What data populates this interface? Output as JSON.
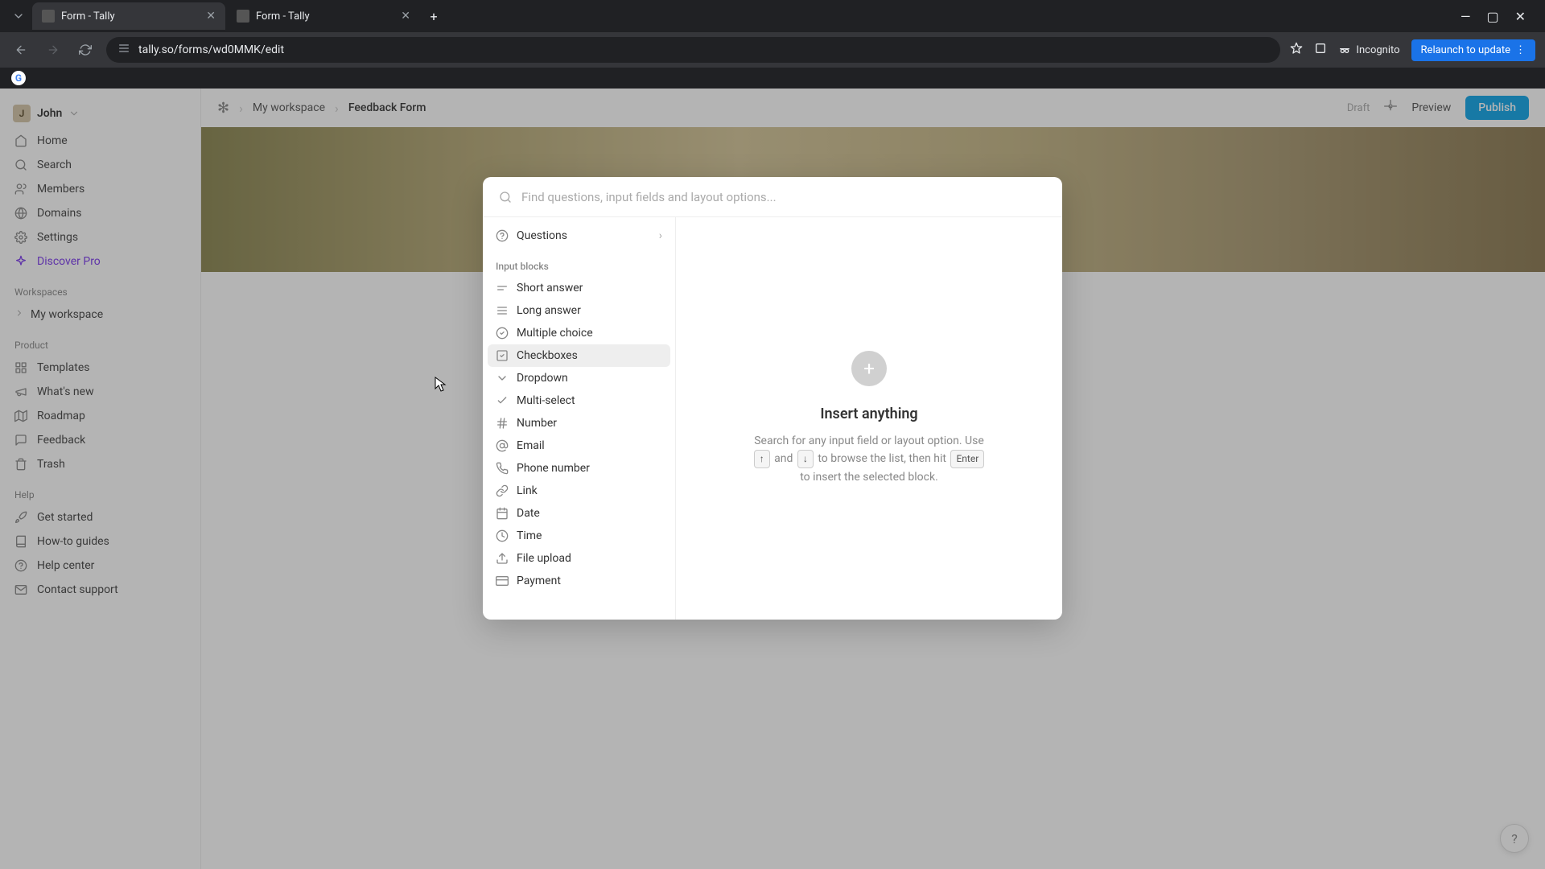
{
  "browser": {
    "tabs": [
      {
        "title": "Form - Tally"
      },
      {
        "title": "Form - Tally"
      }
    ],
    "url": "tally.so/forms/wd0MMK/edit",
    "incognito_label": "Incognito",
    "relaunch_label": "Relaunch to update"
  },
  "user": {
    "initial": "J",
    "name": "John"
  },
  "nav": {
    "home": "Home",
    "search": "Search",
    "members": "Members",
    "domains": "Domains",
    "settings": "Settings",
    "discover_pro": "Discover Pro"
  },
  "sections": {
    "workspaces": "Workspaces",
    "product": "Product",
    "help": "Help"
  },
  "workspace_item": "My workspace",
  "product_nav": {
    "templates": "Templates",
    "whats_new": "What's new",
    "roadmap": "Roadmap",
    "feedback": "Feedback",
    "trash": "Trash"
  },
  "help_nav": {
    "get_started": "Get started",
    "how_to": "How-to guides",
    "help_center": "Help center",
    "contact": "Contact support"
  },
  "breadcrumb": {
    "workspace": "My workspace",
    "form": "Feedback Form"
  },
  "top_actions": {
    "draft": "Draft",
    "preview": "Preview",
    "publish": "Publish"
  },
  "modal": {
    "search_placeholder": "Find questions, input fields and layout options...",
    "questions": "Questions",
    "section_input_blocks": "Input blocks",
    "blocks": {
      "short_answer": "Short answer",
      "long_answer": "Long answer",
      "multiple_choice": "Multiple choice",
      "checkboxes": "Checkboxes",
      "dropdown": "Dropdown",
      "multi_select": "Multi-select",
      "number": "Number",
      "email": "Email",
      "phone": "Phone number",
      "link": "Link",
      "date": "Date",
      "time": "Time",
      "file_upload": "File upload",
      "payment": "Payment"
    },
    "help": {
      "title": "Insert anything",
      "desc_pre": "Search for any input field or layout option. Use ",
      "key_up": "↑",
      "desc_and": " and ",
      "key_down": "↓",
      "desc_browse": " to browse the list, then hit ",
      "key_enter": "Enter",
      "desc_post": " to insert the selected block."
    }
  }
}
